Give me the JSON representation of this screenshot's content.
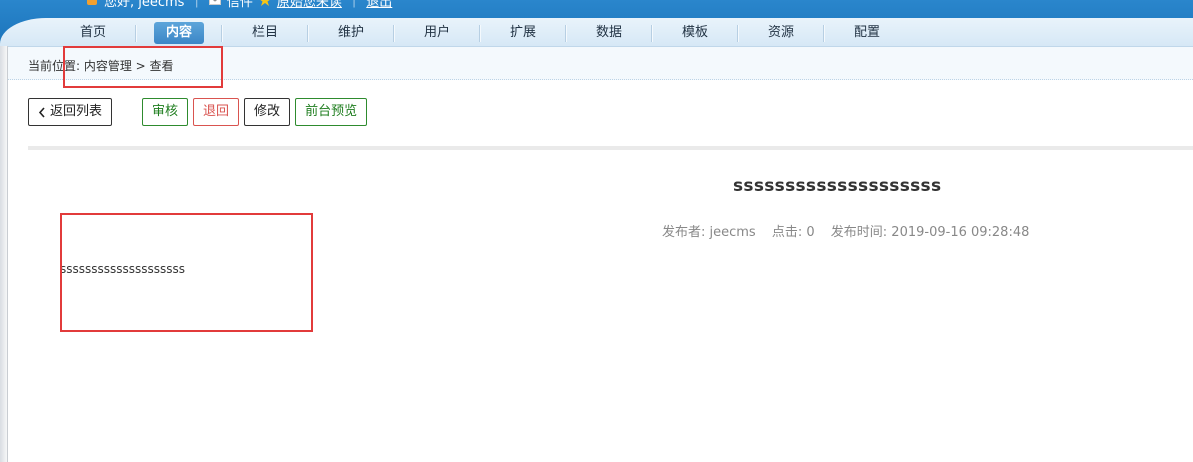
{
  "header": {
    "greeting": "您好, jeecms",
    "message_label": "信件",
    "message_link": "原始您未读",
    "logout": "退出"
  },
  "nav": {
    "items": [
      {
        "label": "首页",
        "active": false
      },
      {
        "label": "内容",
        "active": true
      },
      {
        "label": "栏目",
        "active": false
      },
      {
        "label": "维护",
        "active": false
      },
      {
        "label": "用户",
        "active": false
      },
      {
        "label": "扩展",
        "active": false
      },
      {
        "label": "数据",
        "active": false
      },
      {
        "label": "模板",
        "active": false
      },
      {
        "label": "资源",
        "active": false
      },
      {
        "label": "配置",
        "active": false
      }
    ]
  },
  "breadcrumb": {
    "text": "当前位置: 内容管理 > 查看"
  },
  "toolbar": {
    "back_label": "返回列表",
    "approve_label": "审核",
    "reject_label": "退回",
    "edit_label": "修改",
    "preview_label": "前台预览"
  },
  "article": {
    "title": "ssssssssssssssssssss",
    "publisher": "发布者: jeecms",
    "clicks": "点击: 0",
    "publish_time": "发布时间: 2019-09-16 09:28:48",
    "content": "ssssssssssssssssssss"
  },
  "colors": {
    "header_blue": "#1b74bb",
    "active_tab": "#3b86c6",
    "highlight_red": "#e23b3b",
    "approve_green": "#1e7d1e",
    "reject_red": "#d9534f"
  }
}
